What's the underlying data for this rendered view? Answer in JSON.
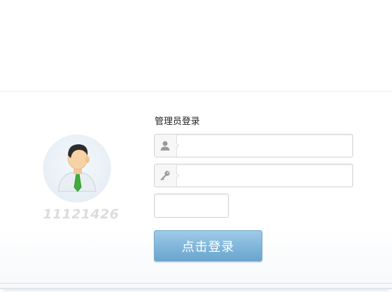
{
  "login": {
    "title": "管理员登录",
    "user_id": "11121426",
    "username": {
      "value": "",
      "placeholder": "",
      "icon": "user-icon"
    },
    "password": {
      "value": "",
      "placeholder": "",
      "icon": "key-icon"
    },
    "captcha": {
      "value": "",
      "placeholder": ""
    },
    "submit_label": "点击登录"
  },
  "colors": {
    "button": "#7fb5da",
    "avatar_bg": "#e7eff6",
    "user_id": "#dcdcdc"
  }
}
